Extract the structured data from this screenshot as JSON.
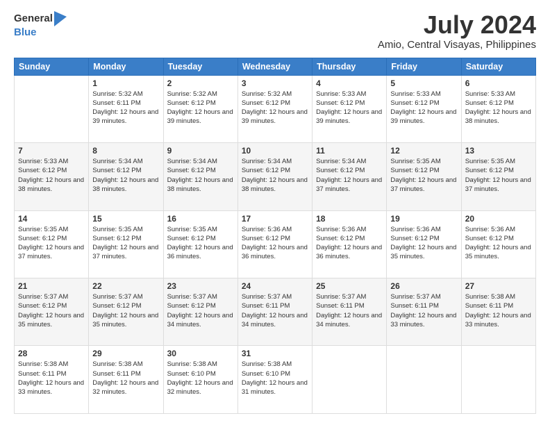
{
  "logo": {
    "text_general": "General",
    "text_blue": "Blue"
  },
  "title": "July 2024",
  "subtitle": "Amio, Central Visayas, Philippines",
  "days_of_week": [
    "Sunday",
    "Monday",
    "Tuesday",
    "Wednesday",
    "Thursday",
    "Friday",
    "Saturday"
  ],
  "weeks": [
    [
      {
        "day": "",
        "sunrise": "",
        "sunset": "",
        "daylight": ""
      },
      {
        "day": "1",
        "sunrise": "Sunrise: 5:32 AM",
        "sunset": "Sunset: 6:11 PM",
        "daylight": "Daylight: 12 hours and 39 minutes."
      },
      {
        "day": "2",
        "sunrise": "Sunrise: 5:32 AM",
        "sunset": "Sunset: 6:12 PM",
        "daylight": "Daylight: 12 hours and 39 minutes."
      },
      {
        "day": "3",
        "sunrise": "Sunrise: 5:32 AM",
        "sunset": "Sunset: 6:12 PM",
        "daylight": "Daylight: 12 hours and 39 minutes."
      },
      {
        "day": "4",
        "sunrise": "Sunrise: 5:33 AM",
        "sunset": "Sunset: 6:12 PM",
        "daylight": "Daylight: 12 hours and 39 minutes."
      },
      {
        "day": "5",
        "sunrise": "Sunrise: 5:33 AM",
        "sunset": "Sunset: 6:12 PM",
        "daylight": "Daylight: 12 hours and 39 minutes."
      },
      {
        "day": "6",
        "sunrise": "Sunrise: 5:33 AM",
        "sunset": "Sunset: 6:12 PM",
        "daylight": "Daylight: 12 hours and 38 minutes."
      }
    ],
    [
      {
        "day": "7",
        "sunrise": "Sunrise: 5:33 AM",
        "sunset": "Sunset: 6:12 PM",
        "daylight": "Daylight: 12 hours and 38 minutes."
      },
      {
        "day": "8",
        "sunrise": "Sunrise: 5:34 AM",
        "sunset": "Sunset: 6:12 PM",
        "daylight": "Daylight: 12 hours and 38 minutes."
      },
      {
        "day": "9",
        "sunrise": "Sunrise: 5:34 AM",
        "sunset": "Sunset: 6:12 PM",
        "daylight": "Daylight: 12 hours and 38 minutes."
      },
      {
        "day": "10",
        "sunrise": "Sunrise: 5:34 AM",
        "sunset": "Sunset: 6:12 PM",
        "daylight": "Daylight: 12 hours and 38 minutes."
      },
      {
        "day": "11",
        "sunrise": "Sunrise: 5:34 AM",
        "sunset": "Sunset: 6:12 PM",
        "daylight": "Daylight: 12 hours and 37 minutes."
      },
      {
        "day": "12",
        "sunrise": "Sunrise: 5:35 AM",
        "sunset": "Sunset: 6:12 PM",
        "daylight": "Daylight: 12 hours and 37 minutes."
      },
      {
        "day": "13",
        "sunrise": "Sunrise: 5:35 AM",
        "sunset": "Sunset: 6:12 PM",
        "daylight": "Daylight: 12 hours and 37 minutes."
      }
    ],
    [
      {
        "day": "14",
        "sunrise": "Sunrise: 5:35 AM",
        "sunset": "Sunset: 6:12 PM",
        "daylight": "Daylight: 12 hours and 37 minutes."
      },
      {
        "day": "15",
        "sunrise": "Sunrise: 5:35 AM",
        "sunset": "Sunset: 6:12 PM",
        "daylight": "Daylight: 12 hours and 37 minutes."
      },
      {
        "day": "16",
        "sunrise": "Sunrise: 5:35 AM",
        "sunset": "Sunset: 6:12 PM",
        "daylight": "Daylight: 12 hours and 36 minutes."
      },
      {
        "day": "17",
        "sunrise": "Sunrise: 5:36 AM",
        "sunset": "Sunset: 6:12 PM",
        "daylight": "Daylight: 12 hours and 36 minutes."
      },
      {
        "day": "18",
        "sunrise": "Sunrise: 5:36 AM",
        "sunset": "Sunset: 6:12 PM",
        "daylight": "Daylight: 12 hours and 36 minutes."
      },
      {
        "day": "19",
        "sunrise": "Sunrise: 5:36 AM",
        "sunset": "Sunset: 6:12 PM",
        "daylight": "Daylight: 12 hours and 35 minutes."
      },
      {
        "day": "20",
        "sunrise": "Sunrise: 5:36 AM",
        "sunset": "Sunset: 6:12 PM",
        "daylight": "Daylight: 12 hours and 35 minutes."
      }
    ],
    [
      {
        "day": "21",
        "sunrise": "Sunrise: 5:37 AM",
        "sunset": "Sunset: 6:12 PM",
        "daylight": "Daylight: 12 hours and 35 minutes."
      },
      {
        "day": "22",
        "sunrise": "Sunrise: 5:37 AM",
        "sunset": "Sunset: 6:12 PM",
        "daylight": "Daylight: 12 hours and 35 minutes."
      },
      {
        "day": "23",
        "sunrise": "Sunrise: 5:37 AM",
        "sunset": "Sunset: 6:12 PM",
        "daylight": "Daylight: 12 hours and 34 minutes."
      },
      {
        "day": "24",
        "sunrise": "Sunrise: 5:37 AM",
        "sunset": "Sunset: 6:11 PM",
        "daylight": "Daylight: 12 hours and 34 minutes."
      },
      {
        "day": "25",
        "sunrise": "Sunrise: 5:37 AM",
        "sunset": "Sunset: 6:11 PM",
        "daylight": "Daylight: 12 hours and 34 minutes."
      },
      {
        "day": "26",
        "sunrise": "Sunrise: 5:37 AM",
        "sunset": "Sunset: 6:11 PM",
        "daylight": "Daylight: 12 hours and 33 minutes."
      },
      {
        "day": "27",
        "sunrise": "Sunrise: 5:38 AM",
        "sunset": "Sunset: 6:11 PM",
        "daylight": "Daylight: 12 hours and 33 minutes."
      }
    ],
    [
      {
        "day": "28",
        "sunrise": "Sunrise: 5:38 AM",
        "sunset": "Sunset: 6:11 PM",
        "daylight": "Daylight: 12 hours and 33 minutes."
      },
      {
        "day": "29",
        "sunrise": "Sunrise: 5:38 AM",
        "sunset": "Sunset: 6:11 PM",
        "daylight": "Daylight: 12 hours and 32 minutes."
      },
      {
        "day": "30",
        "sunrise": "Sunrise: 5:38 AM",
        "sunset": "Sunset: 6:10 PM",
        "daylight": "Daylight: 12 hours and 32 minutes."
      },
      {
        "day": "31",
        "sunrise": "Sunrise: 5:38 AM",
        "sunset": "Sunset: 6:10 PM",
        "daylight": "Daylight: 12 hours and 31 minutes."
      },
      {
        "day": "",
        "sunrise": "",
        "sunset": "",
        "daylight": ""
      },
      {
        "day": "",
        "sunrise": "",
        "sunset": "",
        "daylight": ""
      },
      {
        "day": "",
        "sunrise": "",
        "sunset": "",
        "daylight": ""
      }
    ]
  ]
}
